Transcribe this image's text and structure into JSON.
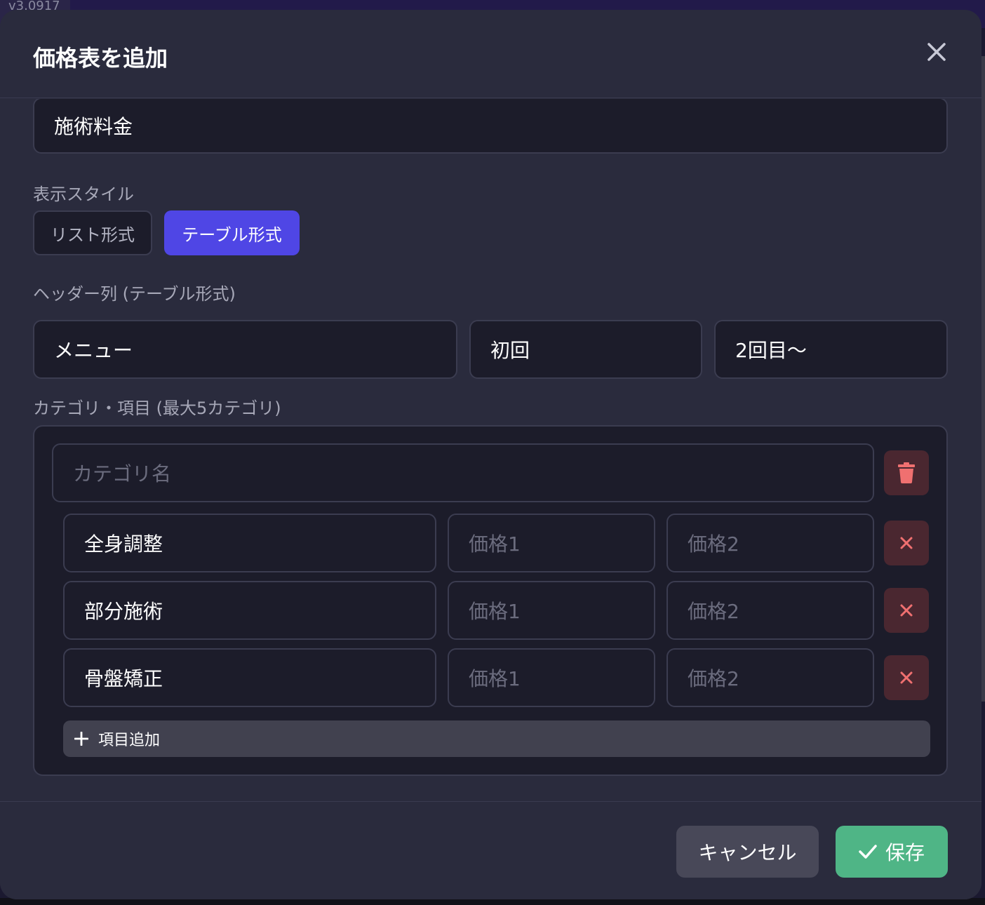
{
  "version_label": "v3.0917",
  "modal": {
    "title": "価格表を追加",
    "close_icon": "close-icon"
  },
  "form": {
    "table_name": "施術料金",
    "display_style": {
      "label": "表示スタイル",
      "options": [
        "リスト形式",
        "テーブル形式"
      ],
      "selected": "テーブル形式"
    },
    "header_columns": {
      "label": "ヘッダー列 (テーブル形式)",
      "values": [
        "メニュー",
        "初回",
        "2回目〜"
      ]
    },
    "categories": {
      "label": "カテゴリ・項目 (最大5カテゴリ)",
      "category_name_placeholder": "カテゴリ名",
      "items": [
        {
          "name": "全身調整",
          "price1_placeholder": "価格1",
          "price2_placeholder": "価格2"
        },
        {
          "name": "部分施術",
          "price1_placeholder": "価格1",
          "price2_placeholder": "価格2"
        },
        {
          "name": "骨盤矯正",
          "price1_placeholder": "価格1",
          "price2_placeholder": "価格2"
        }
      ],
      "add_item_label": "項目追加"
    }
  },
  "footer": {
    "cancel_label": "キャンセル",
    "save_label": "保存"
  },
  "colors": {
    "modal_bg": "#2a2b3d",
    "input_bg": "#1c1c2a",
    "accent": "#4f46e5",
    "save": "#4fb586",
    "danger_icon": "#f07070",
    "danger_bg": "#4a2730"
  }
}
